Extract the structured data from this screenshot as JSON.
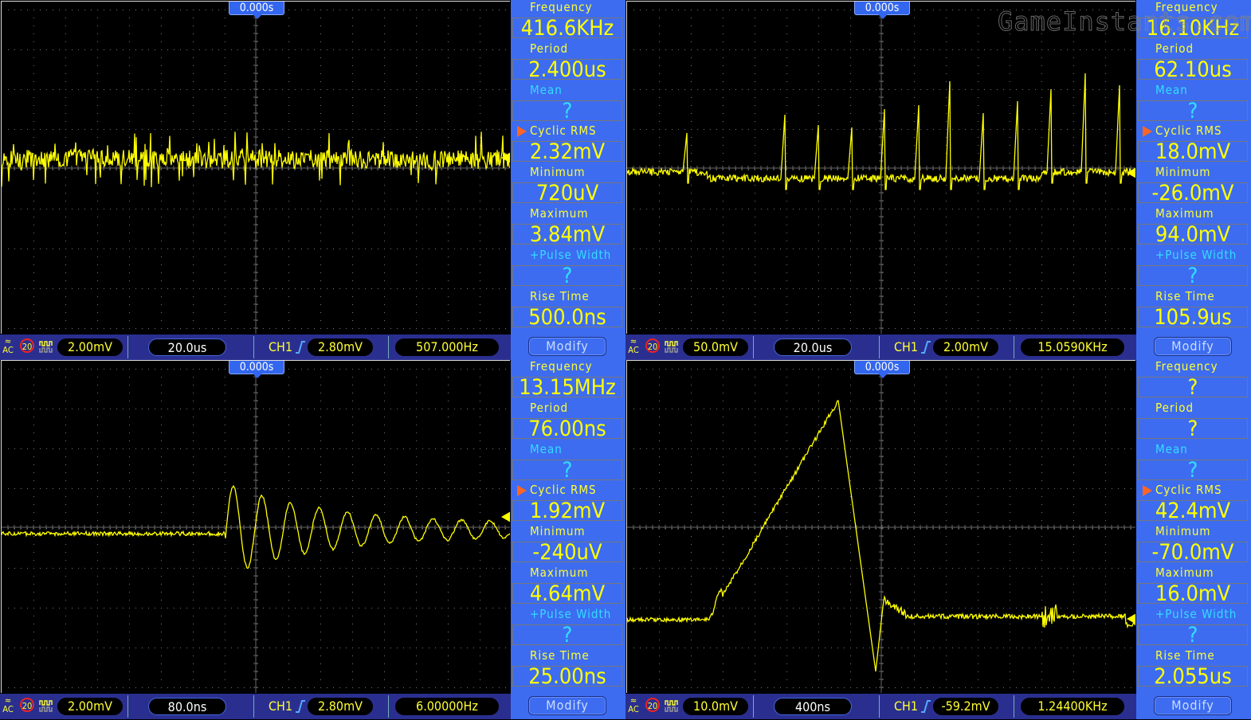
{
  "watermark": "GameInstants.com",
  "colors": {
    "trace": "#ffff00",
    "screen_bg": "#000000",
    "panel_bg": "#3d6cf0",
    "status_bg": "#2a2f8f",
    "label_yellow": "#ffff33",
    "label_cyan": "#33ddff",
    "arrow": "#ff6622",
    "grid": "#777777"
  },
  "scopes": [
    {
      "trigger_time": "0.000s",
      "measurements": [
        {
          "label": "Frequency",
          "value": "416.6KHz",
          "cyan": false,
          "selected": false
        },
        {
          "label": "Period",
          "value": "2.400us",
          "cyan": false,
          "selected": false
        },
        {
          "label": "Mean",
          "value": "?",
          "cyan": true,
          "selected": false
        },
        {
          "label": "Cyclic RMS",
          "value": "2.32mV",
          "cyan": false,
          "selected": true
        },
        {
          "label": "Minimum",
          "value": "720uV",
          "cyan": false,
          "selected": false
        },
        {
          "label": "Maximum",
          "value": "3.84mV",
          "cyan": false,
          "selected": false
        },
        {
          "label": "+Pulse Width",
          "value": "?",
          "cyan": true,
          "selected": false
        },
        {
          "label": "Rise Time",
          "value": "500.0ns",
          "cyan": false,
          "selected": false
        }
      ],
      "modify_label": "Modify",
      "status": {
        "coupling": "AC",
        "bw_limit": "20",
        "volts_div": "2.00mV",
        "time_div": "20.0us",
        "channel": "CH1",
        "trigger_level": "2.80mV",
        "trigger_freq": "507.000Hz"
      },
      "waveform": "noise",
      "trigger_level_fraction": 0.47
    },
    {
      "trigger_time": "0.000s",
      "measurements": [
        {
          "label": "Frequency",
          "value": "16.10KHz",
          "cyan": false,
          "selected": false
        },
        {
          "label": "Period",
          "value": "62.10us",
          "cyan": false,
          "selected": false
        },
        {
          "label": "Mean",
          "value": "?",
          "cyan": true,
          "selected": false
        },
        {
          "label": "Cyclic RMS",
          "value": "18.0mV",
          "cyan": false,
          "selected": true
        },
        {
          "label": "Minimum",
          "value": "-26.0mV",
          "cyan": false,
          "selected": false
        },
        {
          "label": "Maximum",
          "value": "94.0mV",
          "cyan": false,
          "selected": false
        },
        {
          "label": "+Pulse Width",
          "value": "?",
          "cyan": true,
          "selected": false
        },
        {
          "label": "Rise Time",
          "value": "105.9us",
          "cyan": false,
          "selected": false
        }
      ],
      "modify_label": "Modify",
      "status": {
        "coupling": "AC",
        "bw_limit": "20",
        "volts_div": "50.0mV",
        "time_div": "20.0us",
        "channel": "CH1",
        "trigger_level": "2.00mV",
        "trigger_freq": "15.0590KHz"
      },
      "waveform": "pulses",
      "trigger_level_fraction": 0.515
    },
    {
      "trigger_time": "0.000s",
      "measurements": [
        {
          "label": "Frequency",
          "value": "13.15MHz",
          "cyan": false,
          "selected": false
        },
        {
          "label": "Period",
          "value": "76.00ns",
          "cyan": false,
          "selected": false
        },
        {
          "label": "Mean",
          "value": "?",
          "cyan": true,
          "selected": false
        },
        {
          "label": "Cyclic RMS",
          "value": "1.92mV",
          "cyan": false,
          "selected": true
        },
        {
          "label": "Minimum",
          "value": "-240uV",
          "cyan": false,
          "selected": false
        },
        {
          "label": "Maximum",
          "value": "4.64mV",
          "cyan": false,
          "selected": false
        },
        {
          "label": "+Pulse Width",
          "value": "?",
          "cyan": true,
          "selected": false
        },
        {
          "label": "Rise Time",
          "value": "25.00ns",
          "cyan": false,
          "selected": false
        }
      ],
      "modify_label": "Modify",
      "status": {
        "coupling": "AC",
        "bw_limit": "20",
        "volts_div": "2.00mV",
        "time_div": "80.0ns",
        "channel": "CH1",
        "trigger_level": "2.80mV",
        "trigger_freq": "6.00000Hz"
      },
      "waveform": "ringing",
      "trigger_level_fraction": 0.47
    },
    {
      "trigger_time": "0.000s",
      "measurements": [
        {
          "label": "Frequency",
          "value": "?",
          "cyan": false,
          "selected": false
        },
        {
          "label": "Period",
          "value": "?",
          "cyan": false,
          "selected": false
        },
        {
          "label": "Mean",
          "value": "?",
          "cyan": true,
          "selected": false
        },
        {
          "label": "Cyclic RMS",
          "value": "42.4mV",
          "cyan": false,
          "selected": true
        },
        {
          "label": "Minimum",
          "value": "-70.0mV",
          "cyan": false,
          "selected": false
        },
        {
          "label": "Maximum",
          "value": "16.0mV",
          "cyan": false,
          "selected": false
        },
        {
          "label": "+Pulse Width",
          "value": "?",
          "cyan": true,
          "selected": false
        },
        {
          "label": "Rise Time",
          "value": "2.055us",
          "cyan": false,
          "selected": false
        }
      ],
      "modify_label": "Modify",
      "status": {
        "coupling": "AC",
        "bw_limit": "20",
        "volts_div": "10.0mV",
        "time_div": "400ns",
        "channel": "CH1",
        "trigger_level": "-59.2mV",
        "trigger_freq": "1.24400KHz"
      },
      "waveform": "spike",
      "trigger_level_fraction": 0.775
    }
  ]
}
